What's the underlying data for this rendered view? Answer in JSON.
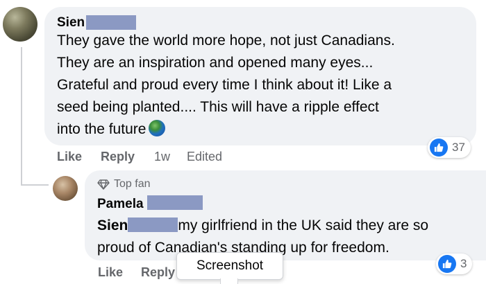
{
  "comment": {
    "author_name": "Sien",
    "text_lines": [
      "They gave the world more hope, not just Canadians.",
      "They are an inspiration and opened many eyes...",
      "Grateful and proud every time I think about it! Like a",
      "seed being planted.... This will have a ripple effect",
      "into the future"
    ],
    "emoji_icon": "globe-emoji",
    "actions": {
      "like": "Like",
      "reply": "Reply",
      "time": "1w",
      "edited": "Edited"
    },
    "reaction_count": "37"
  },
  "reply": {
    "badge": "Top fan",
    "badge_icon": "diamond-icon",
    "author_name": "Pamela",
    "mention": "Sien",
    "text_line1": "my girlfriend in the UK said they are so",
    "text_line2": "proud of Canadian's standing up for freedom.",
    "actions": {
      "like": "Like",
      "reply": "Reply"
    },
    "reaction_count": "3"
  },
  "tooltip": {
    "label": "Screenshot"
  },
  "colors": {
    "bubble": "#f0f2f5",
    "like_blue": "#1877f2",
    "redaction": "#8b99c3",
    "meta_gray": "#65676b"
  }
}
